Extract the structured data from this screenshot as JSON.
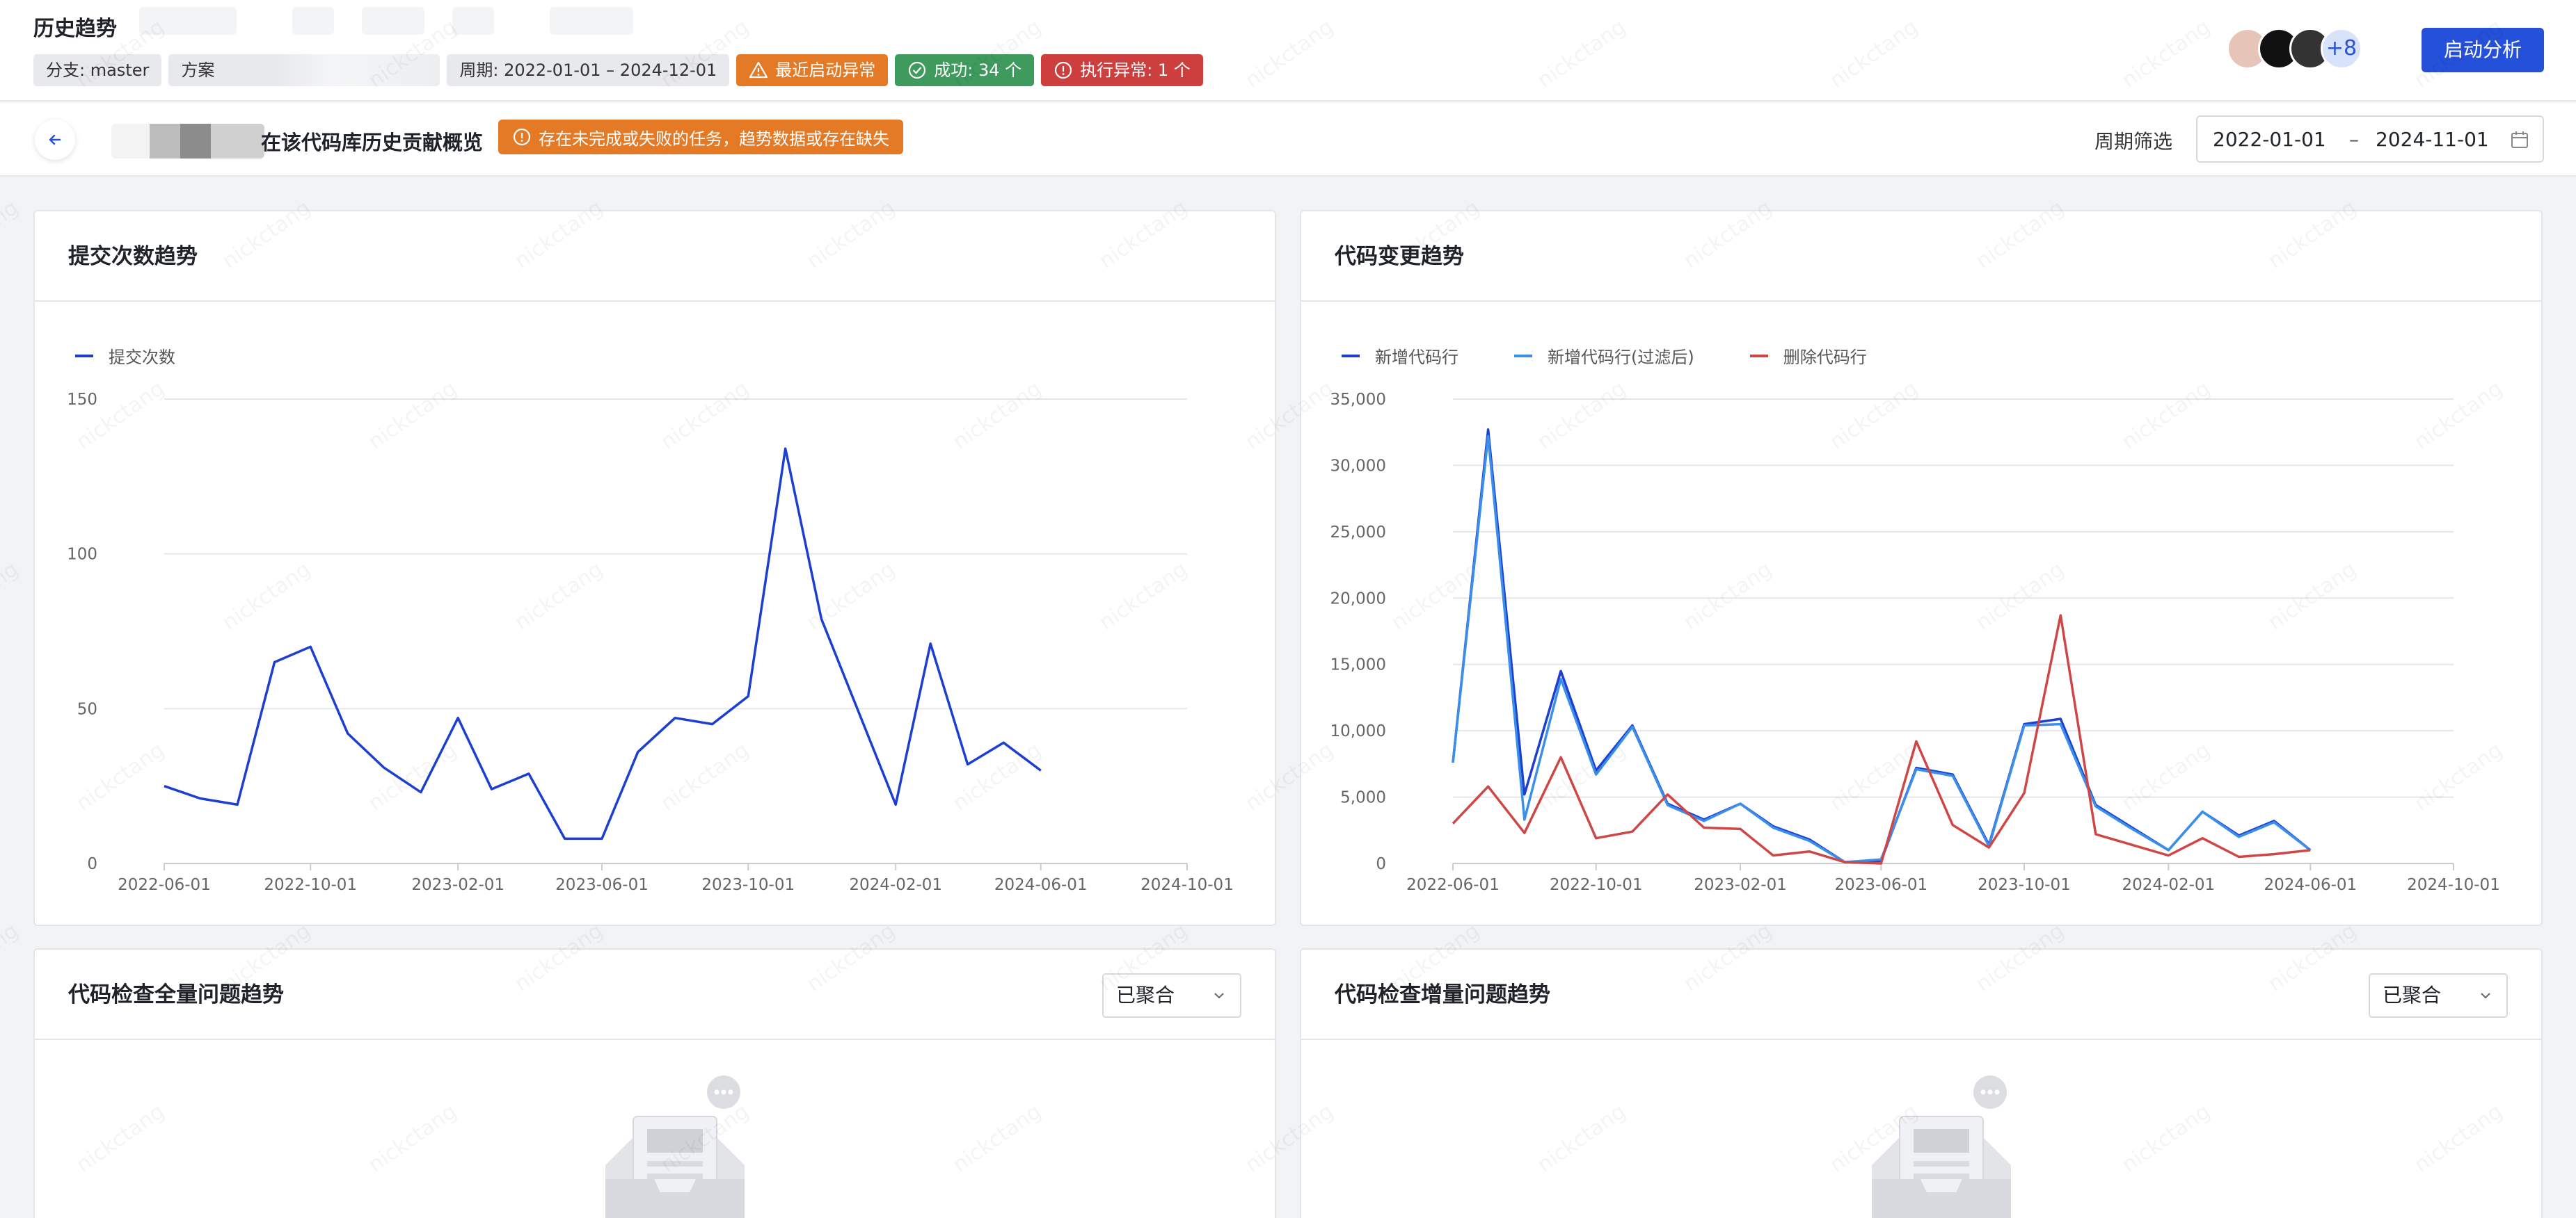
{
  "header": {
    "title": "历史趋势",
    "tags": {
      "branch": "分支: master",
      "scheme": "方案",
      "period": "周期: 2022-01-01 – 2024-12-01",
      "recent_error": "最近启动异常",
      "success": "成功: 34 个",
      "exec_error": "执行异常: 1 个"
    },
    "avatar_more": "+8",
    "start_button": "启动分析",
    "colors": {
      "primary": "#2550d9",
      "warning": "#e47a26",
      "success": "#3e9a5d",
      "danger": "#cd3f3f"
    }
  },
  "subbar": {
    "title": "在该代码库历史贡献概览",
    "warning": "存在未完成或失败的任务，趋势数据或存在缺失",
    "filter_label": "周期筛选",
    "date_start": "2022-01-01",
    "date_sep": "–",
    "date_end": "2024-11-01"
  },
  "commit_card": {
    "title": "提交次数趋势"
  },
  "code_card": {
    "title": "代码变更趋势"
  },
  "issues_all_card": {
    "title": "代码检查全量问题趋势",
    "select_value": "已聚合"
  },
  "issues_inc_card": {
    "title": "代码检查增量问题趋势",
    "select_value": "已聚合"
  },
  "watermark": "nickctang",
  "chart_data": [
    {
      "type": "line",
      "x_tick_labels": [
        "2022-06-01",
        "2022-10-01",
        "2023-02-01",
        "2023-06-01",
        "2023-10-01",
        "2024-02-01",
        "2024-06-01",
        "2024-10-01"
      ],
      "y_tick_labels": [
        "0",
        "50",
        "100",
        "150"
      ],
      "ylim": [
        0,
        150
      ],
      "x_start": "2022-06-01",
      "x_end": "2024-10-01",
      "grid": true,
      "legend": "top-left",
      "series": [
        {
          "name": "提交次数",
          "color": "#1d3fd1",
          "x": [
            "2022-06-01",
            "2022-07-01",
            "2022-08-01",
            "2022-09-01",
            "2022-10-01",
            "2022-11-01",
            "2022-12-01",
            "2023-01-01",
            "2023-02-01",
            "2023-03-01",
            "2023-04-01",
            "2023-05-01",
            "2023-06-01",
            "2023-07-01",
            "2023-08-01",
            "2023-09-01",
            "2023-10-01",
            "2023-11-01",
            "2023-12-01",
            "2024-01-01",
            "2024-02-01",
            "2024-03-01",
            "2024-04-01",
            "2024-05-01",
            "2024-06-01"
          ],
          "values": [
            25,
            21,
            19,
            65,
            70,
            42,
            31,
            23,
            47,
            24,
            29,
            8,
            8,
            36,
            47,
            45,
            54,
            134,
            79,
            49,
            19,
            71,
            32,
            39,
            30
          ]
        }
      ]
    },
    {
      "type": "line",
      "x_tick_labels": [
        "2022-06-01",
        "2022-10-01",
        "2023-02-01",
        "2023-06-01",
        "2023-10-01",
        "2024-02-01",
        "2024-06-01",
        "2024-10-01"
      ],
      "y_tick_labels": [
        "0",
        "5,000",
        "10,000",
        "15,000",
        "20,000",
        "25,000",
        "30,000",
        "35,000"
      ],
      "ylim": [
        0,
        35000
      ],
      "x_start": "2022-06-01",
      "x_end": "2024-10-01",
      "grid": true,
      "legend": "top-left",
      "series": [
        {
          "name": "新增代码行",
          "color": "#1d3fd1",
          "x": [
            "2022-06-01",
            "2022-07-01",
            "2022-08-01",
            "2022-09-01",
            "2022-10-01",
            "2022-11-01",
            "2022-12-01",
            "2023-01-01",
            "2023-02-01",
            "2023-03-01",
            "2023-04-01",
            "2023-05-01",
            "2023-06-01",
            "2023-07-01",
            "2023-08-01",
            "2023-09-01",
            "2023-10-01",
            "2023-11-01",
            "2023-12-01",
            "2024-01-01",
            "2024-02-01",
            "2024-03-01",
            "2024-04-01",
            "2024-05-01",
            "2024-06-01"
          ],
          "values": [
            7600,
            32700,
            5200,
            14500,
            7000,
            10400,
            4500,
            3300,
            4500,
            2800,
            1800,
            100,
            200,
            7200,
            6700,
            1400,
            10500,
            10900,
            4400,
            2700,
            1000,
            3900,
            2100,
            3200,
            1000
          ]
        },
        {
          "name": "新增代码行(过滤后)",
          "color": "#3b8fe8",
          "x": [
            "2022-06-01",
            "2022-07-01",
            "2022-08-01",
            "2022-09-01",
            "2022-10-01",
            "2022-11-01",
            "2022-12-01",
            "2023-01-01",
            "2023-02-01",
            "2023-03-01",
            "2023-04-01",
            "2023-05-01",
            "2023-06-01",
            "2023-07-01",
            "2023-08-01",
            "2023-09-01",
            "2023-10-01",
            "2023-11-01",
            "2023-12-01",
            "2024-01-01",
            "2024-02-01",
            "2024-03-01",
            "2024-04-01",
            "2024-05-01",
            "2024-06-01"
          ],
          "values": [
            7600,
            32200,
            3300,
            13900,
            6700,
            10300,
            4400,
            3200,
            4500,
            2700,
            1700,
            100,
            300,
            7100,
            6600,
            1300,
            10400,
            10500,
            4300,
            2600,
            1000,
            3900,
            2000,
            3100,
            1000
          ]
        },
        {
          "name": "删除代码行",
          "color": "#cf4646",
          "x": [
            "2022-06-01",
            "2022-07-01",
            "2022-08-01",
            "2022-09-01",
            "2022-10-01",
            "2022-11-01",
            "2022-12-01",
            "2023-01-01",
            "2023-02-01",
            "2023-03-01",
            "2023-04-01",
            "2023-05-01",
            "2023-06-01",
            "2023-07-01",
            "2023-08-01",
            "2023-09-01",
            "2023-10-01",
            "2023-11-01",
            "2023-12-01",
            "2024-01-01",
            "2024-02-01",
            "2024-03-01",
            "2024-04-01",
            "2024-05-01",
            "2024-06-01"
          ],
          "values": [
            3000,
            5800,
            2300,
            8000,
            1900,
            2400,
            5200,
            2700,
            2600,
            600,
            900,
            100,
            0,
            9200,
            2900,
            1200,
            5300,
            18700,
            2200,
            1400,
            600,
            1900,
            500,
            700,
            1000
          ]
        }
      ]
    }
  ]
}
